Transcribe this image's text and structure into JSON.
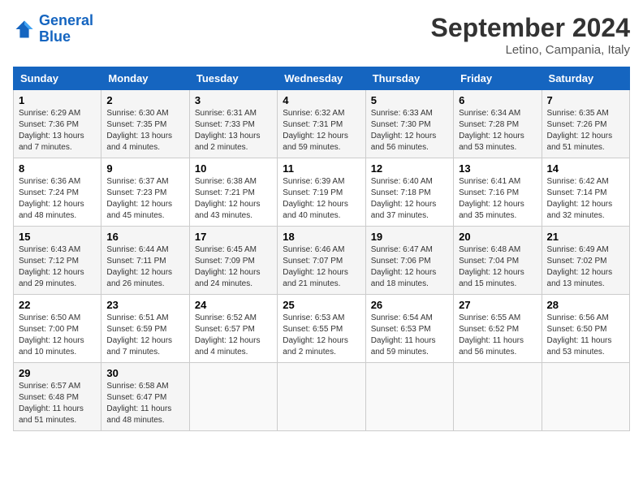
{
  "header": {
    "logo_line1": "General",
    "logo_line2": "Blue",
    "month_title": "September 2024",
    "location": "Letino, Campania, Italy"
  },
  "weekdays": [
    "Sunday",
    "Monday",
    "Tuesday",
    "Wednesday",
    "Thursday",
    "Friday",
    "Saturday"
  ],
  "weeks": [
    [
      {
        "day": "1",
        "info": "Sunrise: 6:29 AM\nSunset: 7:36 PM\nDaylight: 13 hours\nand 7 minutes."
      },
      {
        "day": "2",
        "info": "Sunrise: 6:30 AM\nSunset: 7:35 PM\nDaylight: 13 hours\nand 4 minutes."
      },
      {
        "day": "3",
        "info": "Sunrise: 6:31 AM\nSunset: 7:33 PM\nDaylight: 13 hours\nand 2 minutes."
      },
      {
        "day": "4",
        "info": "Sunrise: 6:32 AM\nSunset: 7:31 PM\nDaylight: 12 hours\nand 59 minutes."
      },
      {
        "day": "5",
        "info": "Sunrise: 6:33 AM\nSunset: 7:30 PM\nDaylight: 12 hours\nand 56 minutes."
      },
      {
        "day": "6",
        "info": "Sunrise: 6:34 AM\nSunset: 7:28 PM\nDaylight: 12 hours\nand 53 minutes."
      },
      {
        "day": "7",
        "info": "Sunrise: 6:35 AM\nSunset: 7:26 PM\nDaylight: 12 hours\nand 51 minutes."
      }
    ],
    [
      {
        "day": "8",
        "info": "Sunrise: 6:36 AM\nSunset: 7:24 PM\nDaylight: 12 hours\nand 48 minutes."
      },
      {
        "day": "9",
        "info": "Sunrise: 6:37 AM\nSunset: 7:23 PM\nDaylight: 12 hours\nand 45 minutes."
      },
      {
        "day": "10",
        "info": "Sunrise: 6:38 AM\nSunset: 7:21 PM\nDaylight: 12 hours\nand 43 minutes."
      },
      {
        "day": "11",
        "info": "Sunrise: 6:39 AM\nSunset: 7:19 PM\nDaylight: 12 hours\nand 40 minutes."
      },
      {
        "day": "12",
        "info": "Sunrise: 6:40 AM\nSunset: 7:18 PM\nDaylight: 12 hours\nand 37 minutes."
      },
      {
        "day": "13",
        "info": "Sunrise: 6:41 AM\nSunset: 7:16 PM\nDaylight: 12 hours\nand 35 minutes."
      },
      {
        "day": "14",
        "info": "Sunrise: 6:42 AM\nSunset: 7:14 PM\nDaylight: 12 hours\nand 32 minutes."
      }
    ],
    [
      {
        "day": "15",
        "info": "Sunrise: 6:43 AM\nSunset: 7:12 PM\nDaylight: 12 hours\nand 29 minutes."
      },
      {
        "day": "16",
        "info": "Sunrise: 6:44 AM\nSunset: 7:11 PM\nDaylight: 12 hours\nand 26 minutes."
      },
      {
        "day": "17",
        "info": "Sunrise: 6:45 AM\nSunset: 7:09 PM\nDaylight: 12 hours\nand 24 minutes."
      },
      {
        "day": "18",
        "info": "Sunrise: 6:46 AM\nSunset: 7:07 PM\nDaylight: 12 hours\nand 21 minutes."
      },
      {
        "day": "19",
        "info": "Sunrise: 6:47 AM\nSunset: 7:06 PM\nDaylight: 12 hours\nand 18 minutes."
      },
      {
        "day": "20",
        "info": "Sunrise: 6:48 AM\nSunset: 7:04 PM\nDaylight: 12 hours\nand 15 minutes."
      },
      {
        "day": "21",
        "info": "Sunrise: 6:49 AM\nSunset: 7:02 PM\nDaylight: 12 hours\nand 13 minutes."
      }
    ],
    [
      {
        "day": "22",
        "info": "Sunrise: 6:50 AM\nSunset: 7:00 PM\nDaylight: 12 hours\nand 10 minutes."
      },
      {
        "day": "23",
        "info": "Sunrise: 6:51 AM\nSunset: 6:59 PM\nDaylight: 12 hours\nand 7 minutes."
      },
      {
        "day": "24",
        "info": "Sunrise: 6:52 AM\nSunset: 6:57 PM\nDaylight: 12 hours\nand 4 minutes."
      },
      {
        "day": "25",
        "info": "Sunrise: 6:53 AM\nSunset: 6:55 PM\nDaylight: 12 hours\nand 2 minutes."
      },
      {
        "day": "26",
        "info": "Sunrise: 6:54 AM\nSunset: 6:53 PM\nDaylight: 11 hours\nand 59 minutes."
      },
      {
        "day": "27",
        "info": "Sunrise: 6:55 AM\nSunset: 6:52 PM\nDaylight: 11 hours\nand 56 minutes."
      },
      {
        "day": "28",
        "info": "Sunrise: 6:56 AM\nSunset: 6:50 PM\nDaylight: 11 hours\nand 53 minutes."
      }
    ],
    [
      {
        "day": "29",
        "info": "Sunrise: 6:57 AM\nSunset: 6:48 PM\nDaylight: 11 hours\nand 51 minutes."
      },
      {
        "day": "30",
        "info": "Sunrise: 6:58 AM\nSunset: 6:47 PM\nDaylight: 11 hours\nand 48 minutes."
      },
      {
        "day": "",
        "info": ""
      },
      {
        "day": "",
        "info": ""
      },
      {
        "day": "",
        "info": ""
      },
      {
        "day": "",
        "info": ""
      },
      {
        "day": "",
        "info": ""
      }
    ]
  ]
}
